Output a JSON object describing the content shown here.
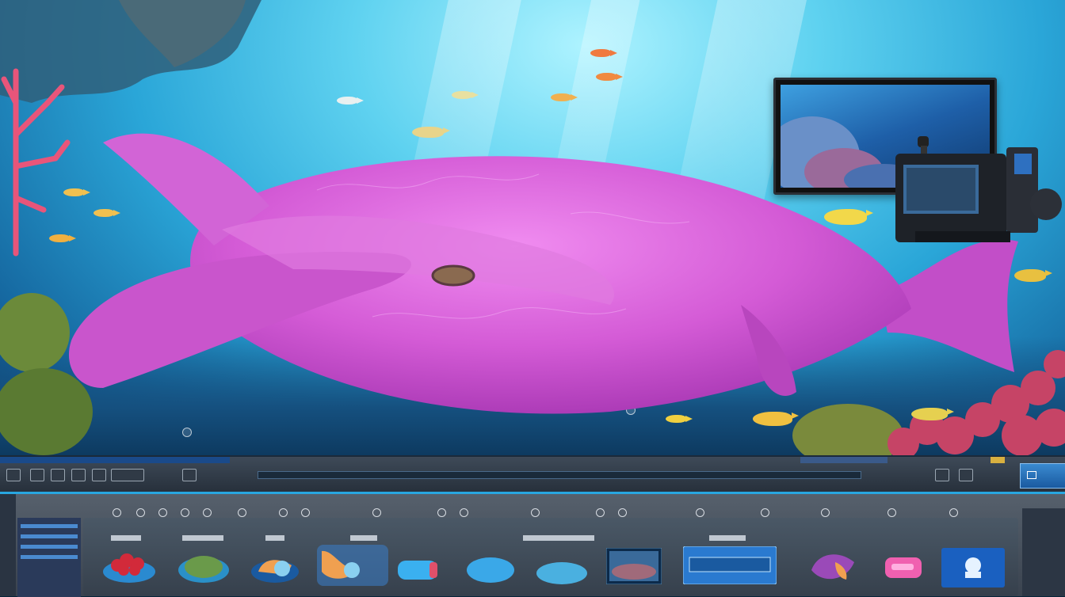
{
  "colors": {
    "water_light": "#aef3ff",
    "water_mid": "#2aa6d8",
    "water_deep": "#0c3f6e",
    "whale_pink": "#d45bd6",
    "toolbar": "#2f3945",
    "panel": "#4a5460",
    "accent_blue": "#28a6e0"
  },
  "scene": {
    "subject": "pink-whale",
    "monitor_icon": "monitor-icon",
    "camera_icon": "video-camera-icon"
  },
  "toolbar": {
    "left_icons": [
      "nav-icon",
      "grid-icon",
      "back-icon",
      "play-icon",
      "slider-icon"
    ],
    "right_button_icon": "window-icon"
  },
  "panel": {
    "assets": [
      {
        "icon": "red-coral-thumbnail"
      },
      {
        "icon": "green-coral-thumbnail"
      },
      {
        "icon": "blue-coral-thumbnail"
      },
      {
        "icon": "orange-shell-thumbnail"
      },
      {
        "icon": "blue-pebble-thumbnail"
      },
      {
        "icon": "blue-stone-thumbnail"
      },
      {
        "icon": "blue-rock-thumbnail"
      },
      {
        "icon": "reef-photo-thumbnail"
      },
      {
        "icon": "blue-frame-thumbnail"
      },
      {
        "icon": "fish-thumbnail"
      },
      {
        "icon": "pink-shape-thumbnail"
      },
      {
        "icon": "bubble-icon-thumbnail"
      }
    ]
  }
}
